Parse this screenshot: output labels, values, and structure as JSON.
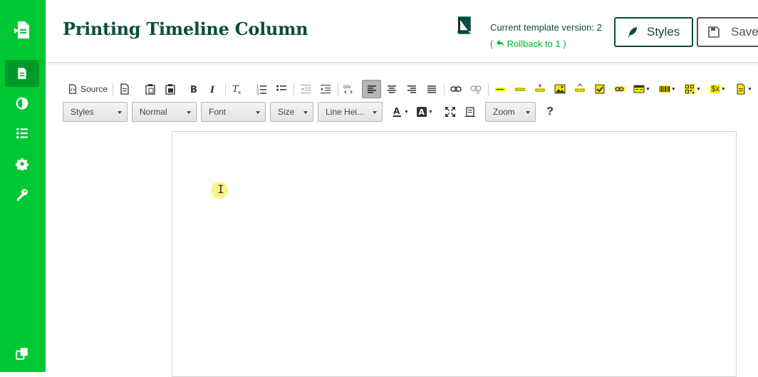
{
  "sidebar": {
    "items": [
      {
        "icon": "document-icon",
        "active": true
      },
      {
        "icon": "contrast-icon",
        "active": false
      },
      {
        "icon": "list-icon",
        "active": false
      },
      {
        "icon": "gear-icon",
        "active": false
      },
      {
        "icon": "key-icon",
        "active": false
      }
    ],
    "bottom_icon": "copy-icon",
    "color": "#00c832",
    "active_color": "#019a29"
  },
  "header": {
    "title": "Printing Timeline Column",
    "version_text": "Current template version: 2",
    "rollback_open": "(",
    "rollback_label": "Rollback to 1",
    "rollback_close": ")",
    "styles_button": "Styles",
    "save_button": "Save",
    "title_color": "#0a4d3f",
    "link_color": "#00b52d"
  },
  "toolbar": {
    "source_label": "Source",
    "combos": {
      "styles": "Styles",
      "format": "Normal",
      "font": "Font",
      "size": "Size",
      "line_height": "Line Hei...",
      "zoom": "Zoom"
    },
    "help_label": "?",
    "div_label": "DIV",
    "variable_label": "$x"
  },
  "editor": {
    "content": ""
  }
}
